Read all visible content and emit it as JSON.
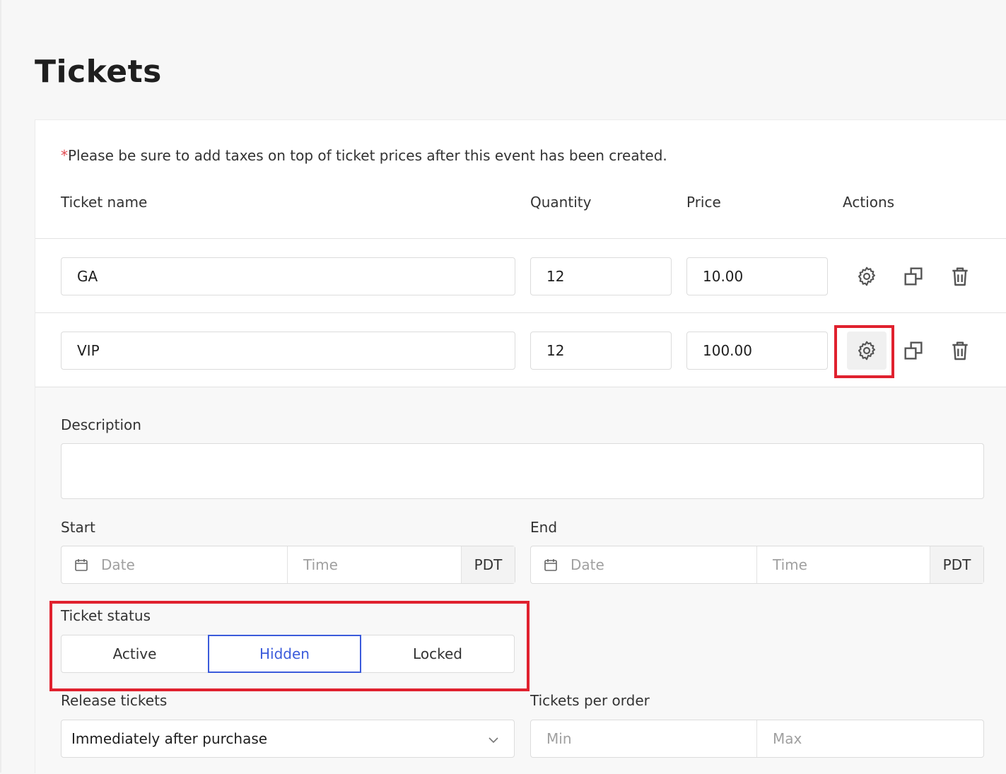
{
  "page": {
    "title": "Tickets"
  },
  "note": {
    "star": "*",
    "text": "Please be sure to add taxes on top of ticket prices after this event has been created."
  },
  "columns": {
    "name": "Ticket name",
    "quantity": "Quantity",
    "price": "Price",
    "actions": "Actions"
  },
  "tickets": [
    {
      "name": "GA",
      "quantity": "12",
      "price": "10.00"
    },
    {
      "name": "VIP",
      "quantity": "12",
      "price": "100.00"
    }
  ],
  "icons": {
    "settings": "gear-icon",
    "duplicate": "copy-icon",
    "delete": "trash-icon"
  },
  "details": {
    "description_label": "Description",
    "description_value": "",
    "start": {
      "label": "Start",
      "date_placeholder": "Date",
      "time_placeholder": "Time",
      "tz": "PDT"
    },
    "end": {
      "label": "End",
      "date_placeholder": "Date",
      "time_placeholder": "Time",
      "tz": "PDT"
    },
    "status": {
      "label": "Ticket status",
      "options": [
        "Active",
        "Hidden",
        "Locked"
      ],
      "selected": "Hidden"
    },
    "release": {
      "label": "Release tickets",
      "value": "Immediately after purchase"
    },
    "per_order": {
      "label": "Tickets per order",
      "min_placeholder": "Min",
      "max_placeholder": "Max"
    }
  },
  "colors": {
    "accent": "#3b5bdb",
    "highlight": "#e0212e",
    "required_star": "#e0484f"
  }
}
